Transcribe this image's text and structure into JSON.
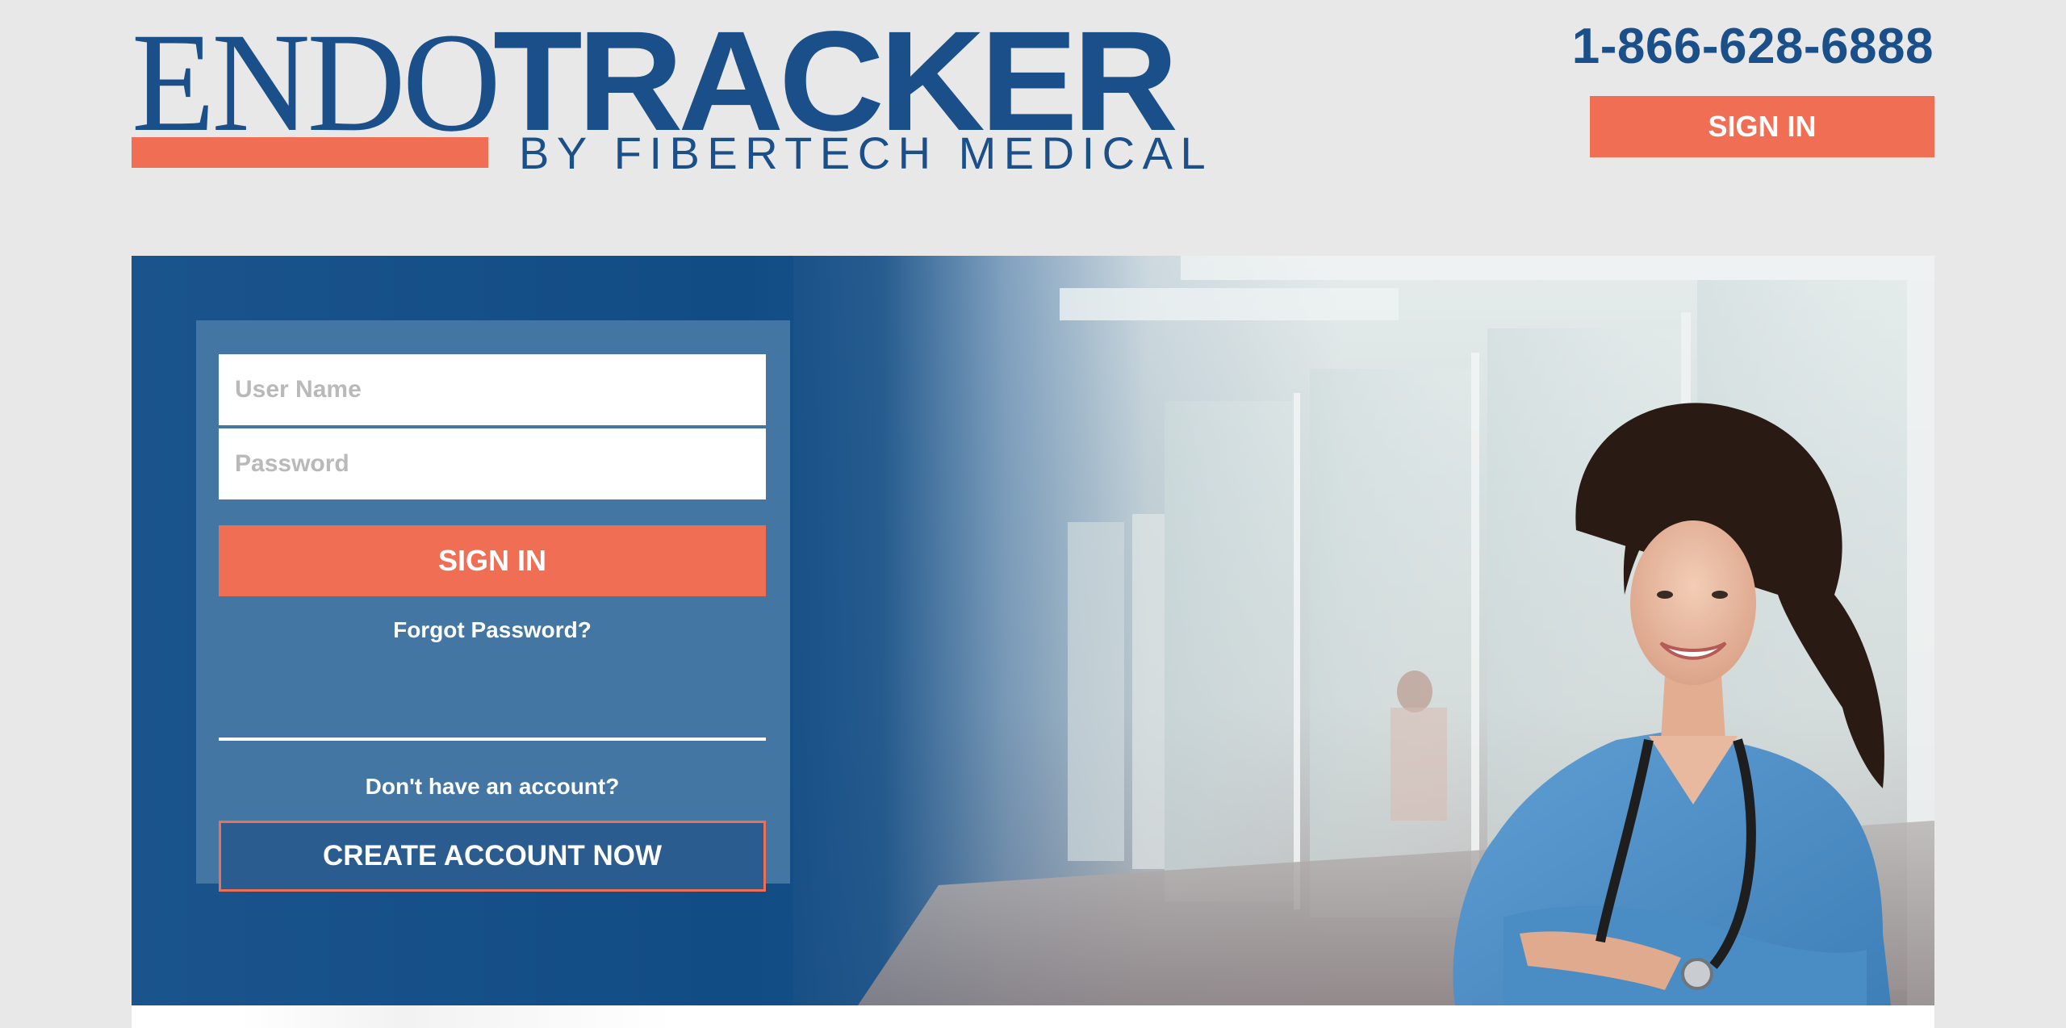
{
  "header": {
    "logo": {
      "endo": "ENDO",
      "tracker": "TRACKER",
      "subtitle": "BY FIBERTECH MEDICAL"
    },
    "phone": "1-866-628-6888",
    "sign_in_label": "SIGN IN"
  },
  "login": {
    "username_placeholder": "User Name",
    "password_placeholder": "Password",
    "sign_in_label": "SIGN IN",
    "forgot_password": "Forgot Password?",
    "no_account_text": "Don't have an account?",
    "create_account_label": "CREATE ACCOUNT NOW"
  },
  "colors": {
    "brand_blue": "#1b4f8a",
    "accent_orange": "#f06e53",
    "panel_blue": "#4376a2",
    "page_background": "#e8e8e8"
  },
  "hero_image": "smiling-nurse-in-blue-scrubs-with-stethoscope-in-hospital-corridor"
}
